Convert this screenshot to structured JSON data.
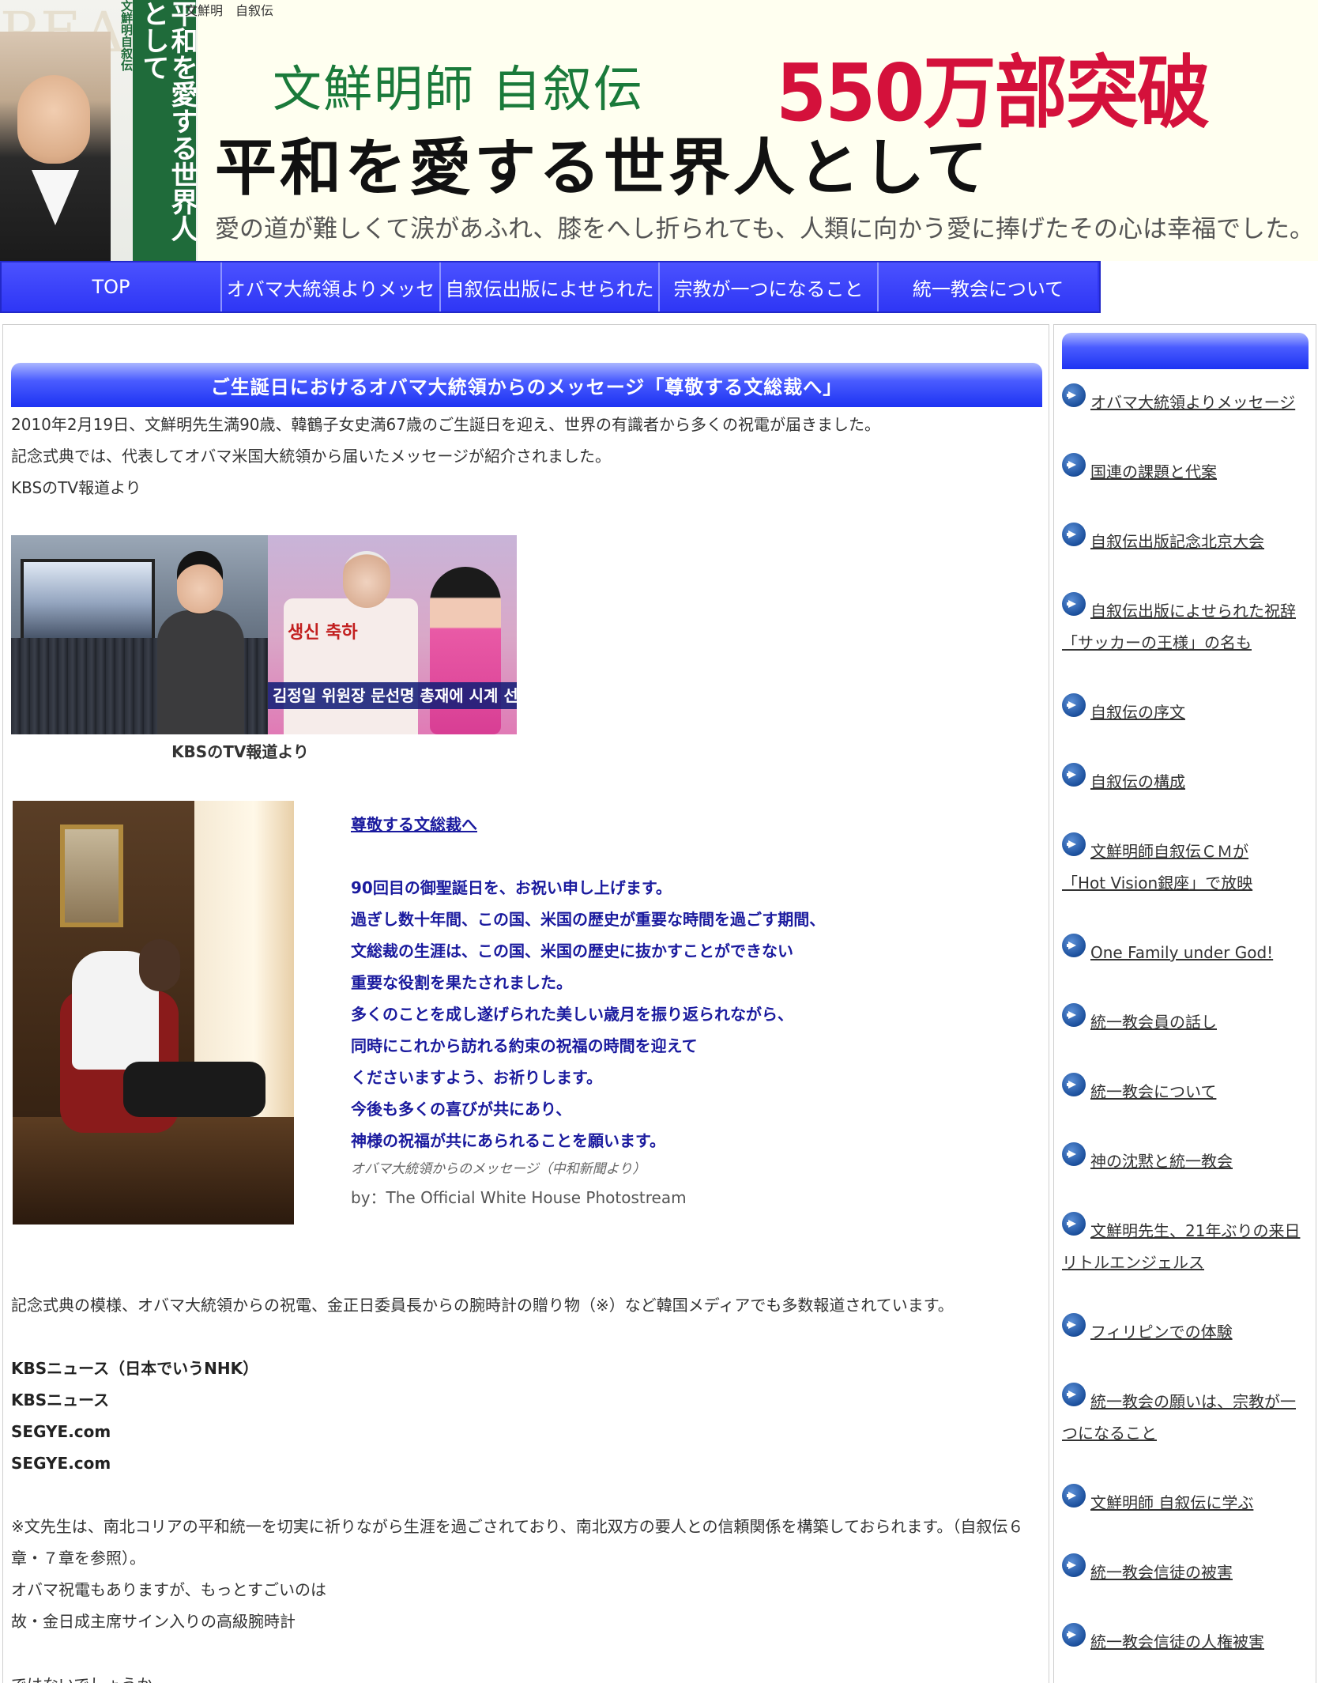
{
  "header": {
    "top_label": "文鮮明　自叙伝",
    "book": {
      "spine_title": "平和を愛する世界人として",
      "author": "文鮮明自叙伝",
      "ghost": "PEA"
    },
    "banner_title": "文鮮明師 自叙伝",
    "banner_red": "550万部突破",
    "banner_main": "平和を愛する世界人として",
    "banner_sub": "愛の道が難しくて涙があふれ、膝をへし折られても、人類に向かう愛に捧げたその心は幸福でした。"
  },
  "nav": {
    "items": [
      "TOP",
      "オバマ大統領よりメッセ",
      "自叙伝出版によせられた",
      "宗教が一つになること",
      "統一教会について"
    ]
  },
  "article": {
    "heading": "ご生誕日におけるオバマ大統領からのメッセージ「尊敬する文総裁へ」",
    "intro": [
      "2010年2月19日、文鮮明先生満90歳、韓鶴子女史満67歳のご生誕日を迎え、世界の有識者から多くの祝電が届きました。",
      "記念式典では、代表してオバマ米国大統領から届いたメッセージが紹介されました。",
      "KBSのTV報道より"
    ],
    "kbs_photo": {
      "cake_text": "생신 축하",
      "ticker": "김정일 위원장 문선명 총재에 시계 선물"
    },
    "kbs_caption": "KBSのTV報道より",
    "message": {
      "link": "尊敬する文総裁へ",
      "lines": [
        "90回目の御聖誕日を、お祝い申し上げます。",
        "過ぎし数十年間、この国、米国の歴史が重要な時間を過ごす期間、",
        "文総裁の生涯は、この国、米国の歴史に抜かすことができない",
        "重要な役割を果たされました。",
        "多くのことを成し遂げられた美しい歳月を振り返られながら、",
        "同時にこれから訪れる約束の祝福の時間を迎えて",
        "くださいますよう、お祈りします。",
        "今後も多くの喜びが共にあり、",
        "神様の祝福が共にあられることを願います。"
      ],
      "source": "オバマ大統領からのメッセージ（中和新聞より）",
      "credit": "by：The Official White House Photostream"
    },
    "summary": "記念式典の模様、オバマ大統領からの祝電、金正日委員長からの腕時計の贈り物（※）など韓国メディアでも多数報道されています。",
    "links": [
      "KBSニュース（日本でいうNHK）",
      "KBSニュース",
      "SEGYE.com",
      "SEGYE.com"
    ],
    "note_lines": [
      "※文先生は、南北コリアの平和統一を切実に祈りながら生涯を過ごされており、南北双方の要人との信頼関係を構築しておられます。（自叙伝６",
      "章・７章を参照）。",
      "オバマ祝電もありますが、もっとすごいのは",
      "故・金日成主席サイン入りの高級腕時計"
    ],
    "closing": "ではないでしょうか"
  },
  "sidebar": {
    "items": [
      {
        "line1": "オバマ大統領よりメッセージ",
        "line2": ""
      },
      {
        "line1": "国連の課題と代案",
        "line2": ""
      },
      {
        "line1": "自叙伝出版記念北京大会",
        "line2": ""
      },
      {
        "line1": "自叙伝出版によせられた祝辞",
        "line2": "「サッカーの王様」の名も"
      },
      {
        "line1": "自叙伝の序文",
        "line2": ""
      },
      {
        "line1": "自叙伝の構成",
        "line2": ""
      },
      {
        "line1": "文鮮明師自叙伝ＣＭが",
        "line2": "「Hot Vision銀座」で放映"
      },
      {
        "line1": "One Family under God!",
        "line2": ""
      },
      {
        "line1": "統一教会員の話し",
        "line2": ""
      },
      {
        "line1": "統一教会について",
        "line2": ""
      },
      {
        "line1": "神の沈黙と統一教会",
        "line2": ""
      },
      {
        "line1": "文鮮明先生、21年ぶりの来日",
        "line2": "リトルエンジェルス"
      },
      {
        "line1": "フィリピンでの体験",
        "line2": ""
      },
      {
        "line1": "統一教会の願いは、宗教が一",
        "line2": "つになること"
      },
      {
        "line1": "文鮮明師 自叙伝に学ぶ",
        "line2": ""
      },
      {
        "line1": "統一教会信徒の被害",
        "line2": ""
      },
      {
        "line1": "統一教会信徒の人権被害",
        "line2": ""
      }
    ]
  }
}
